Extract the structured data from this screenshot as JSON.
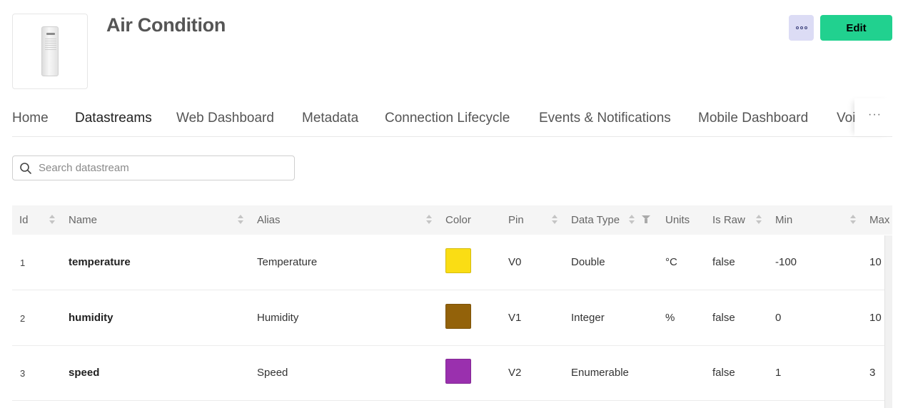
{
  "device": {
    "title": "Air Condition",
    "thumbnail_icon": "air-conditioner-image"
  },
  "actions": {
    "more_icon": "more-options-icon",
    "edit_label": "Edit"
  },
  "tabs": [
    {
      "label": "Home",
      "active": false
    },
    {
      "label": "Datastreams",
      "active": true
    },
    {
      "label": "Web Dashboard",
      "active": false
    },
    {
      "label": "Metadata",
      "active": false
    },
    {
      "label": "Connection Lifecycle",
      "active": false
    },
    {
      "label": "Events & Notifications",
      "active": false
    },
    {
      "label": "Mobile Dashboard",
      "active": false
    },
    {
      "label": "Voi",
      "active": false
    }
  ],
  "tabs_more": "···",
  "search": {
    "placeholder": "Search datastream",
    "value": ""
  },
  "table": {
    "columns": [
      "Id",
      "Name",
      "Alias",
      "Color",
      "Pin",
      "Data Type",
      "Units",
      "Is Raw",
      "Min",
      "Max"
    ],
    "rows": [
      {
        "id": "1",
        "name": "temperature",
        "alias": "Temperature",
        "color": "#FADD14",
        "pin": "V0",
        "data_type": "Double",
        "units": "°C",
        "is_raw": "false",
        "min": "-100",
        "max": "10"
      },
      {
        "id": "2",
        "name": "humidity",
        "alias": "Humidity",
        "color": "#93620A",
        "pin": "V1",
        "data_type": "Integer",
        "units": "%",
        "is_raw": "false",
        "min": "0",
        "max": "10"
      },
      {
        "id": "3",
        "name": "speed",
        "alias": "Speed",
        "color": "#9A30AE",
        "pin": "V2",
        "data_type": "Enumerable",
        "units": "",
        "is_raw": "false",
        "min": "1",
        "max": "3"
      }
    ]
  },
  "colors": {
    "accent": "#21D18F",
    "more_button_bg": "#DCDCF5"
  }
}
